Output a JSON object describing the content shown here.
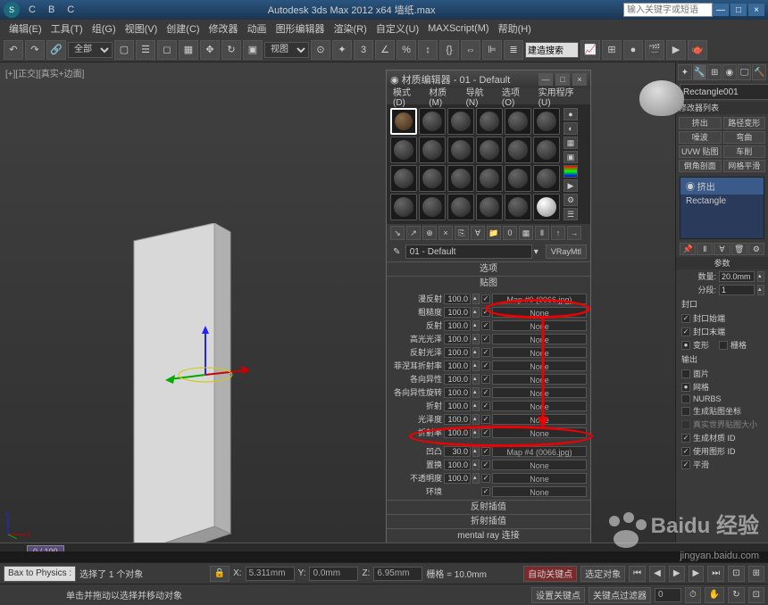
{
  "titlebar": {
    "logo": "S",
    "menu": [
      "C",
      "B",
      "C"
    ],
    "title": "Autodesk 3ds Max 2012 x64   墙纸.max",
    "search_placeholder": "输入关键字或短语",
    "minimize": "—",
    "maximize": "□",
    "close": "×"
  },
  "menubar": [
    "编辑(E)",
    "工具(T)",
    "组(G)",
    "视图(V)",
    "创建(C)",
    "修改器",
    "动画",
    "图形编辑器",
    "渲染(R)",
    "自定义(U)",
    "MAXScript(M)",
    "帮助(H)"
  ],
  "toolbar": {
    "select_mode": "全部",
    "render_preset": "建造搜索"
  },
  "viewport": {
    "label": "[+][正交][真实+边面]"
  },
  "mat_editor": {
    "title": "材质编辑器 - 01 - Default",
    "menu": [
      "模式(D)",
      "材质(M)",
      "导航(N)",
      "选项(O)",
      "实用程序(U)"
    ],
    "name_input": "01 - Default",
    "type_btn": "VRayMtl",
    "rollout_options": "选项",
    "rollout_maps": "贴图",
    "rows": [
      {
        "lbl": "漫反射",
        "val": "100.0",
        "map": "Map #0 (0066.jpg)"
      },
      {
        "lbl": "粗糙度",
        "val": "100.0",
        "map": "None"
      },
      {
        "lbl": "反射",
        "val": "100.0",
        "map": "None"
      },
      {
        "lbl": "高光光泽",
        "val": "100.0",
        "map": "None"
      },
      {
        "lbl": "反射光泽",
        "val": "100.0",
        "map": "None"
      },
      {
        "lbl": "菲涅耳折射率",
        "val": "100.0",
        "map": "None"
      },
      {
        "lbl": "各向异性",
        "val": "100.0",
        "map": "None"
      },
      {
        "lbl": "各向异性旋转",
        "val": "100.0",
        "map": "None"
      },
      {
        "lbl": "折射",
        "val": "100.0",
        "map": "None"
      },
      {
        "lbl": "光泽度",
        "val": "100.0",
        "map": "None"
      },
      {
        "lbl": "折射率",
        "val": "100.0",
        "map": "None"
      },
      {
        "lbl": "",
        "val": "",
        "map": ""
      },
      {
        "lbl": "凹凸",
        "val": "30.0",
        "map": "Map #4 (0066.jpg)"
      },
      {
        "lbl": "置换",
        "val": "100.0",
        "map": "None"
      },
      {
        "lbl": "不透明度",
        "val": "100.0",
        "map": "None"
      },
      {
        "lbl": "环境",
        "val": "",
        "map": "None"
      }
    ],
    "rollout_reflect": "反射插值",
    "rollout_refract": "折射插值",
    "rollout_mental": "mental ray 连接"
  },
  "rpanel": {
    "objname": "Rectangle001",
    "modlist_hdr": "修改器列表",
    "row1": [
      "挤出",
      "路径变形"
    ],
    "row2": [
      "噪波",
      "弯曲"
    ],
    "row3": [
      "UVW 贴图",
      "车削"
    ],
    "row4": [
      "倒角剖面",
      "网格平滑"
    ],
    "stack": [
      "挤出",
      "Rectangle"
    ],
    "params_hdr": "参数",
    "amount_lbl": "数量:",
    "amount_val": "20.0mm",
    "segments_lbl": "分段:",
    "segments_val": "1",
    "cap_hdr": "封口",
    "cap_start": "封口始端",
    "cap_end": "封口末端",
    "cap_morph": "变形",
    "cap_grid": "栅格",
    "output_hdr": "输出",
    "out_patch": "面片",
    "out_mesh": "网格",
    "out_nurbs": "NURBS",
    "gen_mapping": "生成贴图坐标",
    "real_world": "真实世界贴图大小",
    "gen_matids": "生成材质 ID",
    "use_shape": "使用图形 ID",
    "smooth": "平滑"
  },
  "timeline": {
    "pos": "0 / 100"
  },
  "status": {
    "bake": "Bax to Physics :",
    "selected": "选择了 1 个对象",
    "hint": "单击并拖动以选择并移动对象",
    "lock": "🔒",
    "x_lbl": "X:",
    "x_val": "5.311mm",
    "y_lbl": "Y:",
    "y_val": "0.0mm",
    "z_lbl": "Z:",
    "z_val": "6.95mm",
    "grid_lbl": "栅格 = 10.0mm",
    "autokey": "自动关键点",
    "selobj": "选定对象",
    "setkey": "设置关键点",
    "keyfilter": "关键点过滤器"
  },
  "watermark": {
    "big": "Baidu 经验",
    "small": "jingyan.baidu.com"
  }
}
